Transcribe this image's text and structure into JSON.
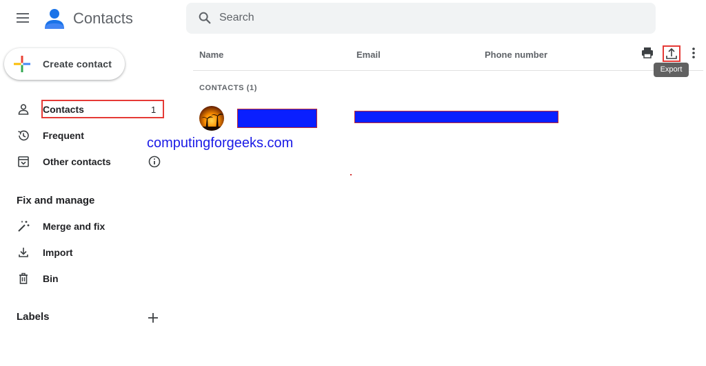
{
  "app": {
    "title": "Contacts"
  },
  "search": {
    "placeholder": "Search",
    "value": ""
  },
  "sidebar": {
    "create_label": "Create contact",
    "items": [
      {
        "label": "Contacts",
        "count": "1",
        "icon": "person-icon"
      },
      {
        "label": "Frequent",
        "icon": "history-icon"
      },
      {
        "label": "Other contacts",
        "icon": "archive-icon",
        "info_icon": "info-icon"
      }
    ],
    "fix_manage": {
      "heading": "Fix and manage",
      "items": [
        {
          "label": "Merge and fix",
          "icon": "magic-wand-icon"
        },
        {
          "label": "Import",
          "icon": "download-icon"
        },
        {
          "label": "Bin",
          "icon": "trash-icon"
        }
      ]
    },
    "labels": {
      "heading": "Labels",
      "add_icon": "plus-icon"
    }
  },
  "table": {
    "columns": [
      "Name",
      "Email",
      "Phone number"
    ],
    "group_label": "CONTACTS (1)",
    "rows": [
      {
        "avatar": "avatar-image",
        "name": "",
        "email": "",
        "phone": ""
      }
    ]
  },
  "toolbar": {
    "print_icon": "print-icon",
    "export_icon": "export-icon",
    "more_icon": "more-vert-icon",
    "export_tooltip": "Export"
  },
  "watermark": "computingforgeeks.com",
  "colors": {
    "highlight": "#e53935",
    "redaction": "#0a1fff",
    "watermark": "#1a1ae6",
    "logo_blue": "#1a73e8"
  }
}
